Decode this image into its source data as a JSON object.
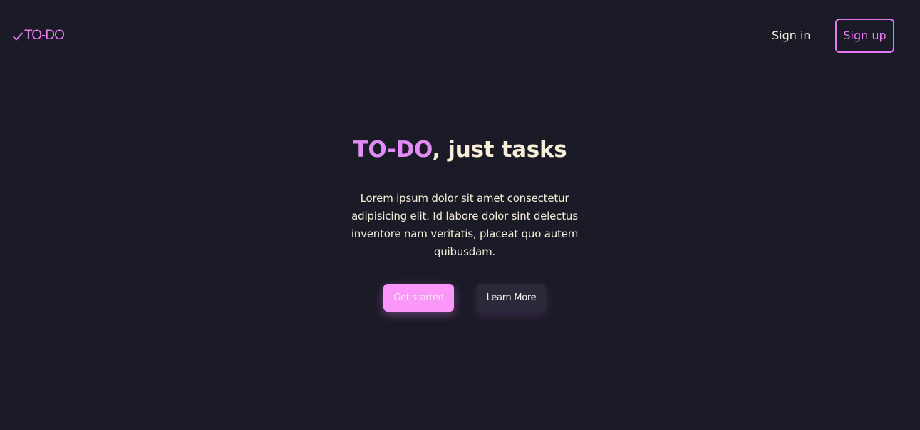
{
  "header": {
    "logo_text": "TO-DO",
    "logo_icon": "check-icon",
    "signin_label": "Sign in",
    "signup_label": "Sign up"
  },
  "hero": {
    "title_brand": "TO-DO",
    "title_rest": ", just tasks",
    "description": "Lorem ipsum dolor sit amet consectetur adipisicing elit. Id labore dolor sint delectus inventore nam veritatis, placeat quo autem quibusdam.",
    "primary_button": "Get started",
    "secondary_button": "Learn More"
  },
  "colors": {
    "background": "#1b1a27",
    "accent": "#e879f5",
    "primary_button": "#fa97f8",
    "text": "#f8efd9",
    "secondary_button": "#2b2839"
  }
}
